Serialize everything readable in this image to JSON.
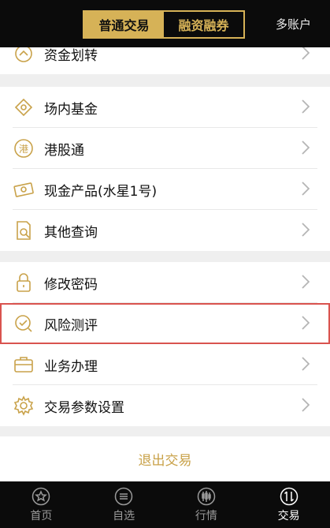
{
  "header": {
    "tab_normal": "普通交易",
    "tab_margin": "融资融券",
    "account": "多账户"
  },
  "colors": {
    "accent": "#d6b257",
    "highlight_border": "#d9534f"
  },
  "menu": {
    "group1": [
      {
        "label": "资金划转",
        "icon": "transfer-icon"
      }
    ],
    "group2": [
      {
        "label": "场内基金",
        "icon": "fund-icon"
      },
      {
        "label": "港股通",
        "icon": "hk-connect-icon"
      },
      {
        "label": "现金产品(水星1号)",
        "icon": "cash-product-icon"
      },
      {
        "label": "其他查询",
        "icon": "query-icon"
      }
    ],
    "group3": [
      {
        "label": "修改密码",
        "icon": "lock-icon"
      },
      {
        "label": "风险测评",
        "icon": "risk-assessment-icon"
      },
      {
        "label": "业务办理",
        "icon": "briefcase-icon"
      },
      {
        "label": "交易参数设置",
        "icon": "settings-gear-icon"
      }
    ]
  },
  "logout": "退出交易",
  "tabbar": {
    "home": "首页",
    "watchlist": "自选",
    "market": "行情",
    "trade": "交易"
  }
}
